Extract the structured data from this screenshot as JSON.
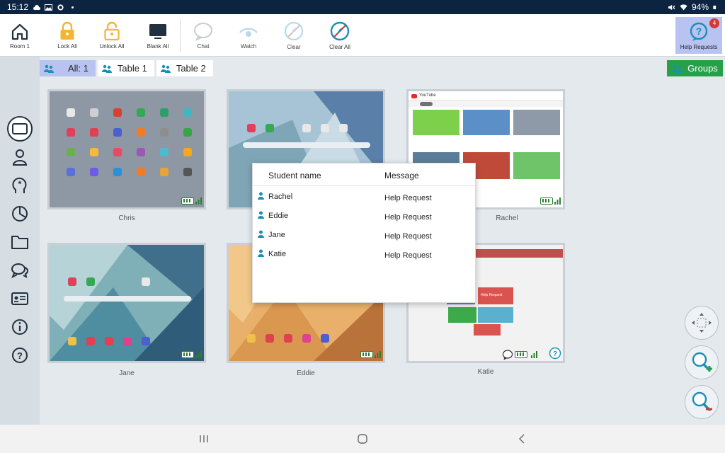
{
  "status_bar": {
    "time": "15:12",
    "battery_percent": "94%"
  },
  "toolbar": {
    "room_label": "Room 1",
    "tools": [
      {
        "label": "Lock All",
        "icon": "lock-icon"
      },
      {
        "label": "Unlock All",
        "icon": "unlock-icon"
      },
      {
        "label": "Blank All",
        "icon": "monitor-icon"
      },
      {
        "label": "Chat",
        "icon": "chat-icon"
      },
      {
        "label": "Watch",
        "icon": "eye-icon"
      },
      {
        "label": "Clear",
        "icon": "clear-icon"
      },
      {
        "label": "Clear All",
        "icon": "clear-all-icon"
      }
    ],
    "help_requests_label": "Help Requests",
    "help_requests_count": "4"
  },
  "sidebar": {
    "items": [
      {
        "name": "home-icon"
      },
      {
        "name": "screen-icon",
        "active": true
      },
      {
        "name": "student-icon"
      },
      {
        "name": "head-star-icon"
      },
      {
        "name": "pie-chart-icon"
      },
      {
        "name": "folder-icon"
      },
      {
        "name": "chat-bubbles-icon"
      },
      {
        "name": "id-card-icon"
      },
      {
        "name": "info-icon"
      },
      {
        "name": "help-icon"
      }
    ]
  },
  "tabs": [
    {
      "label": "All: 1",
      "active": true
    },
    {
      "label": "Table 1",
      "active": false
    },
    {
      "label": "Table 2",
      "active": false
    }
  ],
  "groups_label": "Groups",
  "devices": [
    {
      "name": "Chris",
      "screen": "app-grid"
    },
    {
      "name": "",
      "screen": "lock-screen"
    },
    {
      "name": "Rachel",
      "screen": "video-browser",
      "app_label": "YouTube"
    },
    {
      "name": "Jane",
      "screen": "home-screen"
    },
    {
      "name": "Eddie",
      "screen": "home-screen-orange"
    },
    {
      "name": "Katie",
      "screen": "web-app",
      "app_label": "Help Request"
    }
  ],
  "popup": {
    "col_student": "Student name",
    "col_message": "Message",
    "rows": [
      {
        "student": "Rachel",
        "message": "Help Request"
      },
      {
        "student": "Eddie",
        "message": "Help Request"
      },
      {
        "student": "Jane",
        "message": "Help Request"
      },
      {
        "student": "Katie",
        "message": "Help Request"
      }
    ]
  },
  "colors": {
    "status_bar": "#0d2440",
    "accent_blue": "#1a8fb5",
    "groups_green": "#27a049",
    "active_tab": "#b9c3f1",
    "lock_yellow": "#f2b632"
  }
}
